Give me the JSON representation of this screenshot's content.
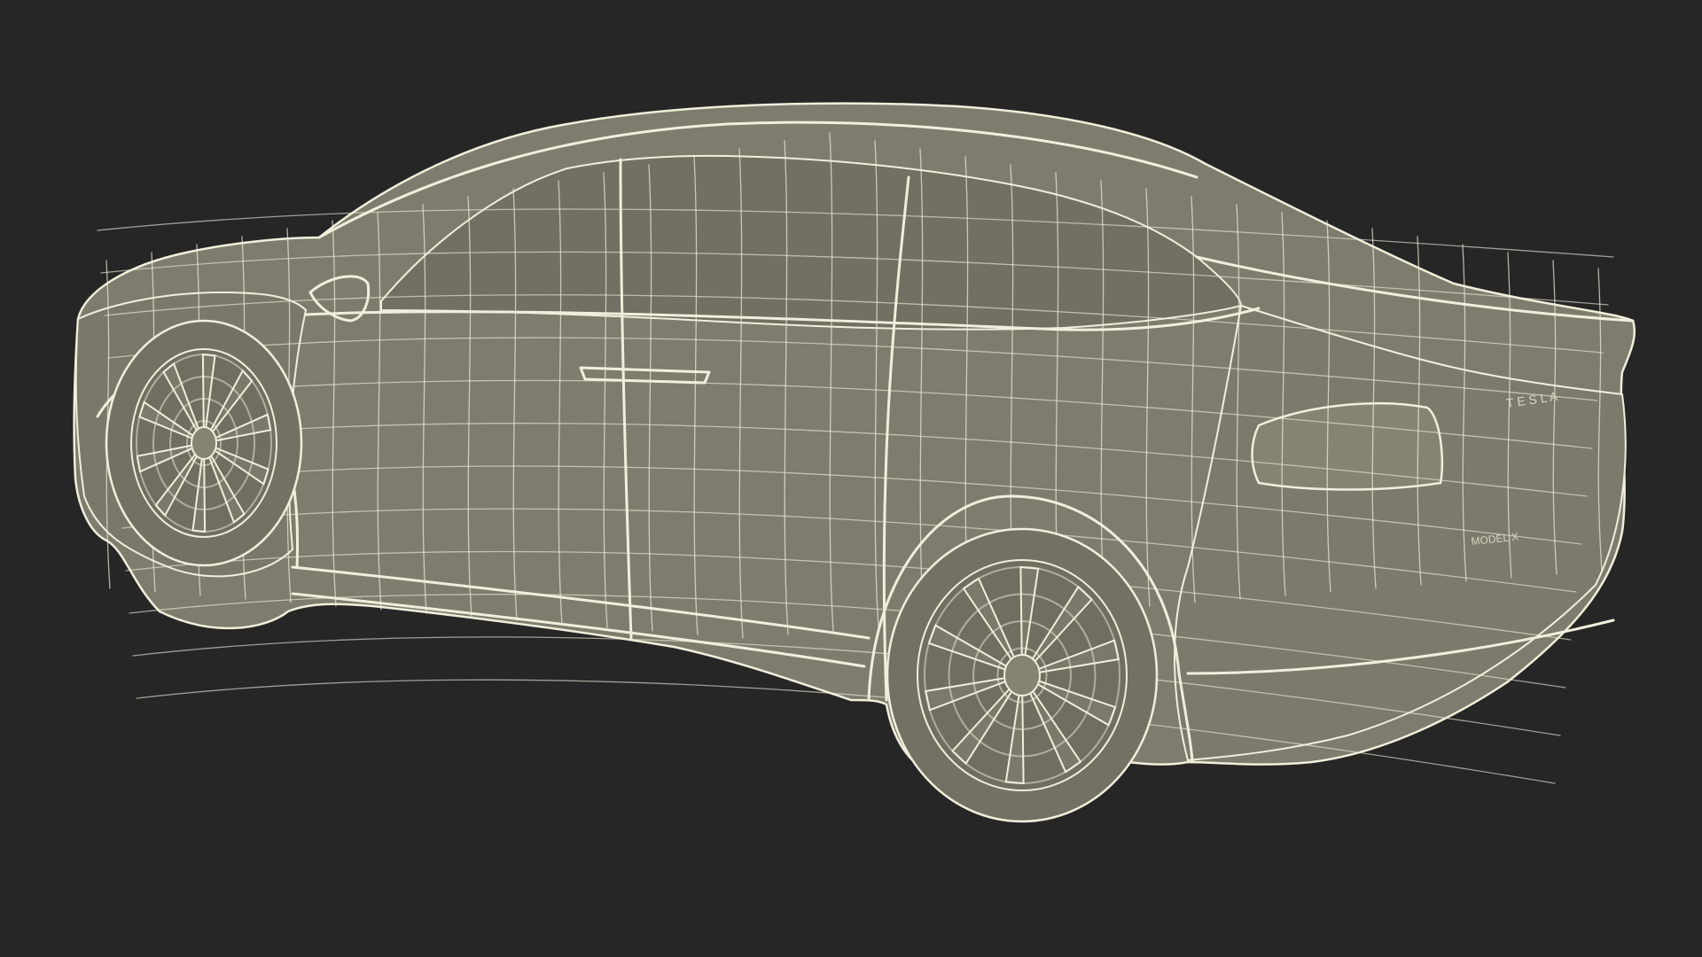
{
  "scene": {
    "subject": "wireframe-car",
    "colors": {
      "background": "#262626",
      "surface": "#7e7d6d",
      "surface_dark": "#6e6d5f",
      "glass": "#707062",
      "wire": "#f1eedb",
      "wire_dim": "#d8d5c0"
    },
    "badge_text": {
      "brand": "T E S L A",
      "model": "MODEL X"
    }
  }
}
